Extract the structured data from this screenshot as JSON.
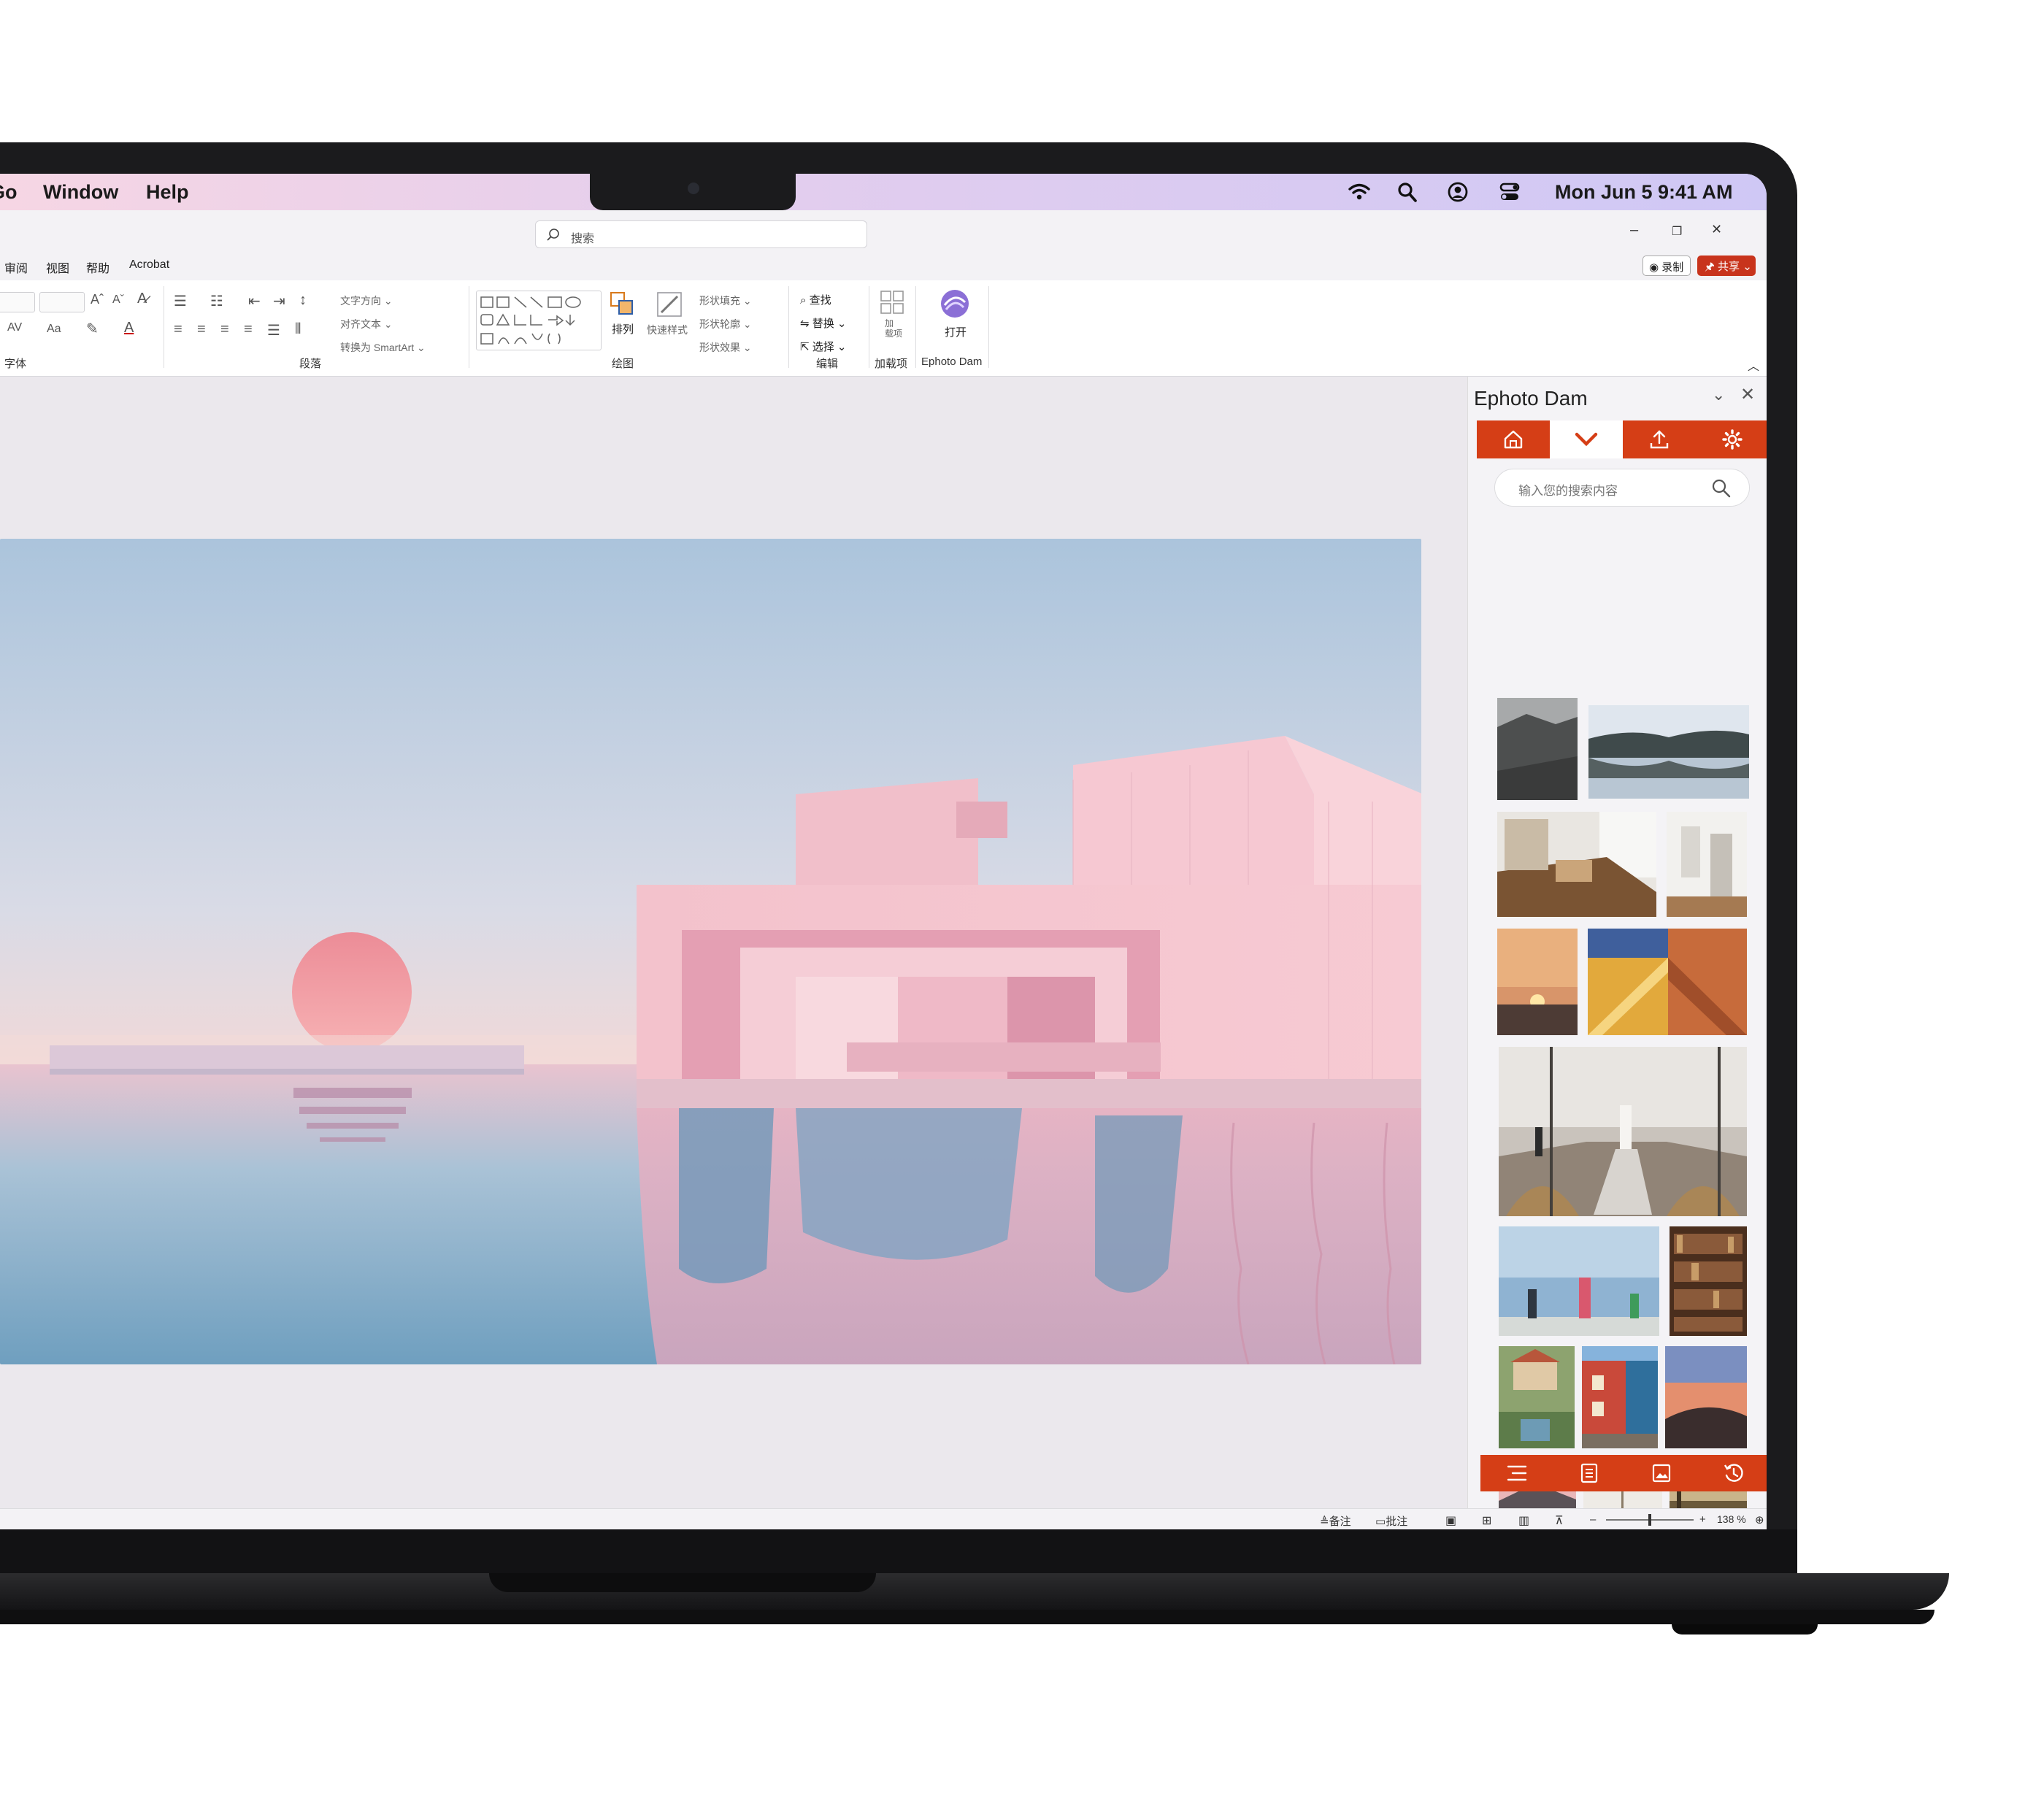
{
  "menubar": {
    "items": [
      "Go",
      "Window",
      "Help"
    ],
    "clock": "Mon Jun 5  9:41 AM"
  },
  "titlebar": {
    "search_placeholder": "搜索",
    "minimize": "–",
    "restore": "❐",
    "close": "✕"
  },
  "tabs": {
    "items": [
      "审阅",
      "视图",
      "帮助",
      "Acrobat"
    ],
    "record": "◉ 录制",
    "share": "🖈 共享 ⌄"
  },
  "ribbon": {
    "font_group": "字体",
    "paragraph_group": "段落",
    "drawing_group": "绘图",
    "editing_group": "编辑",
    "addins_group": "加载项",
    "ephoto_group": "Ephoto Dam",
    "text_direction": "文字方向 ⌄",
    "align_text": "对齐文本 ⌄",
    "convert_smartart": "转换为 SmartArt ⌄",
    "arrange": "排列",
    "quick_styles": "快速样式",
    "shape_fill": "形状填充 ⌄",
    "shape_outline": "形状轮廓 ⌄",
    "shape_effects": "形状效果 ⌄",
    "find": "查找",
    "replace": "替换 ⌄",
    "select": "选择 ⌄",
    "addins": "加\n载项",
    "open": "打开"
  },
  "pane": {
    "title": "Ephoto Dam",
    "search_placeholder": "输入您的搜索内容",
    "nav": [
      "home-icon",
      "chevron-down-icon",
      "upload-icon",
      "gear-icon"
    ],
    "footer": [
      "list-icon",
      "document-icon",
      "image-icon",
      "history-icon"
    ]
  },
  "statusbar": {
    "notes": "备注",
    "comments": "批注",
    "zoom_minus": "–",
    "zoom_plus": "+",
    "zoom": "138 %"
  },
  "colors": {
    "accent": "#d53e16",
    "share": "#c8341c"
  }
}
